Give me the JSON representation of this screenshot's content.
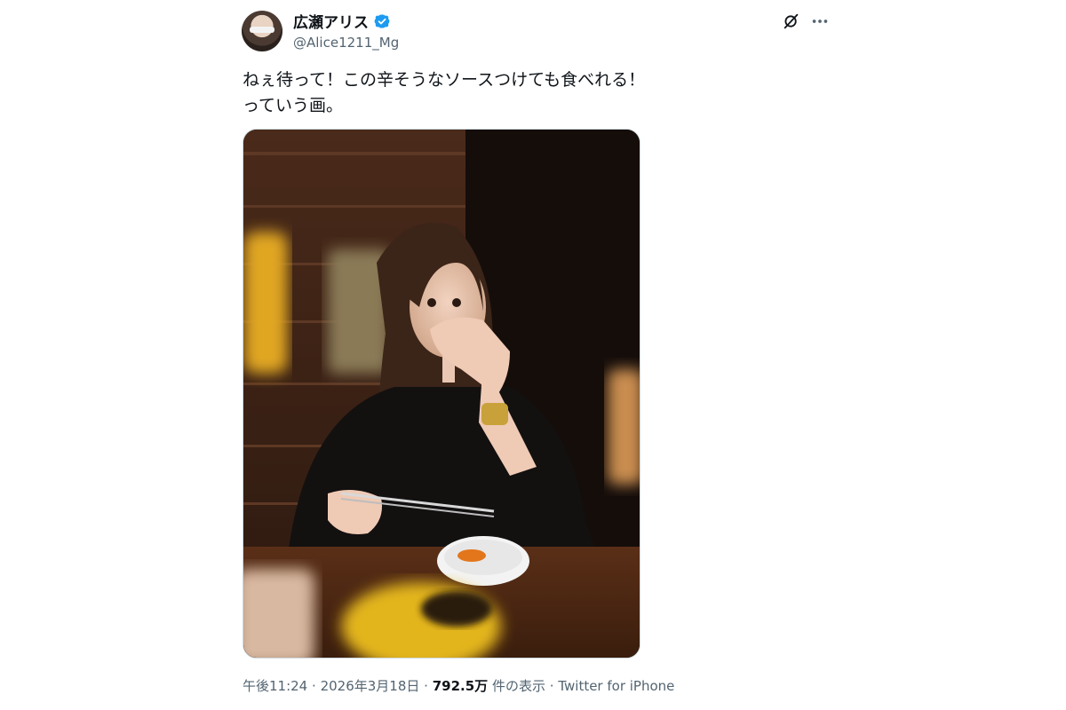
{
  "tweet": {
    "author": {
      "display_name": "広瀬アリス",
      "handle": "@Alice1211_Mg",
      "verified": true,
      "verified_color": "#1d9bf0"
    },
    "text": "ねぇ待って！この辛そうなソースつけても食べれる！\nっていう画。",
    "media": {
      "type": "photo",
      "icon": "photo"
    },
    "meta": {
      "time": "午後11:24",
      "separator": "·",
      "date": "2026年3月18日",
      "views_count": "792.5万",
      "views_label": "件の表示",
      "source": "Twitter for iPhone"
    }
  },
  "actions": {
    "grok_icon": "grok-icon",
    "more_icon": "more-icon"
  },
  "colors": {
    "text_primary": "#0f1419",
    "text_secondary": "#536471",
    "border": "#cfd9de"
  }
}
